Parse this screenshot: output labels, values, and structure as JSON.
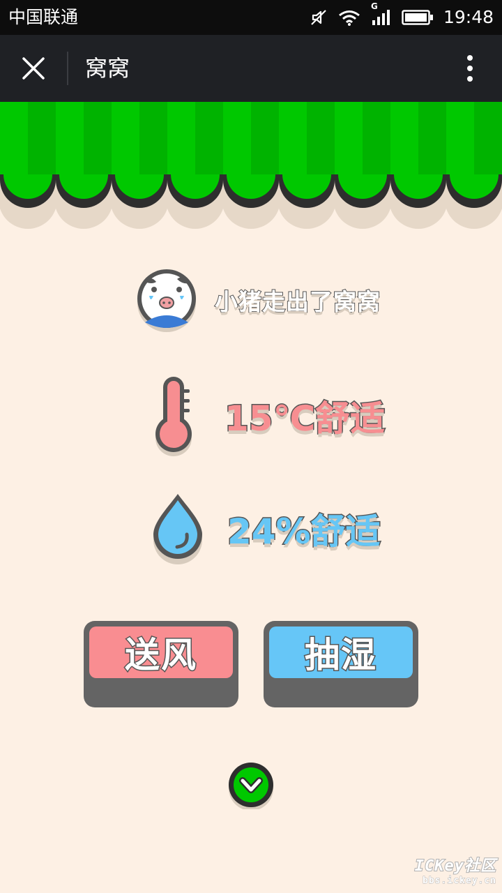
{
  "status_bar": {
    "carrier": "中国联通",
    "network_label": "G",
    "time": "19:48",
    "icons": [
      "mute-icon",
      "wifi-icon",
      "signal-icon",
      "battery-icon"
    ]
  },
  "nav": {
    "title": "窝窝",
    "close_icon": "close-icon",
    "more_icon": "more-vertical-icon"
  },
  "status": {
    "message": "小猪走出了窝窝",
    "temperature": "15℃舒适",
    "humidity": "24%舒适"
  },
  "buttons": {
    "fan_label": "送风",
    "dehumidify_label": "抽湿"
  },
  "watermark": {
    "main": "ICKey社区",
    "sub": "bbs.ickey.cn"
  },
  "colors": {
    "background": "#fdf0e4",
    "awning_green": "#00c800",
    "fan_pink": "#f98d91",
    "dehumidify_blue": "#66c6f7",
    "nav_bar": "#1f2125"
  }
}
